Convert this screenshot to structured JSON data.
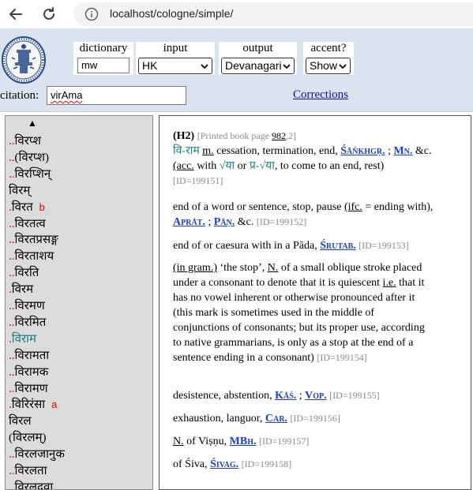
{
  "browser": {
    "url": "localhost/cologne/simple/"
  },
  "header": {
    "dictionary": {
      "label": "dictionary",
      "value": "mw"
    },
    "input": {
      "label": "input",
      "value": "HK"
    },
    "output": {
      "label": "output",
      "value": "Devanagari"
    },
    "accent": {
      "label": "accent?",
      "value": "Show"
    },
    "citation": {
      "label": "citation:",
      "value": "virAma"
    },
    "corrections": "Corrections"
  },
  "list": {
    "up_arrow": "▲",
    "items": [
      {
        "dots": "..",
        "text": "विरप्श",
        "mark": ""
      },
      {
        "dots": "..",
        "text": "(विरप्श)",
        "mark": ""
      },
      {
        "dots": "..",
        "text": "विरप्शिन्",
        "mark": ""
      },
      {
        "dots": "",
        "text": "विरम्",
        "mark": ""
      },
      {
        "dots": ".",
        "text": "विरत",
        "mark": "b"
      },
      {
        "dots": "..",
        "text": "विरतत्व",
        "mark": ""
      },
      {
        "dots": "..",
        "text": "विरतप्रसङ्ग",
        "mark": ""
      },
      {
        "dots": "..",
        "text": "विरताशय",
        "mark": ""
      },
      {
        "dots": "..",
        "text": "विरति",
        "mark": ""
      },
      {
        "dots": ".",
        "text": "विरम",
        "mark": ""
      },
      {
        "dots": "..",
        "text": "विरमण",
        "mark": ""
      },
      {
        "dots": "..",
        "text": "विरमित",
        "mark": ""
      },
      {
        "dots": ".",
        "text": "विराम",
        "mark": "",
        "selected": true
      },
      {
        "dots": "..",
        "text": "विरामता",
        "mark": ""
      },
      {
        "dots": "..",
        "text": "विरामक",
        "mark": ""
      },
      {
        "dots": "..",
        "text": "विरामण",
        "mark": ""
      },
      {
        "dots": ".",
        "text": "विरिरंसा",
        "mark": "a"
      },
      {
        "dots": "",
        "text": "विरल",
        "mark": ""
      },
      {
        "dots": "",
        "text": "(विरलम्)",
        "mark": ""
      },
      {
        "dots": "..",
        "text": "विरलजानुक",
        "mark": ""
      },
      {
        "dots": "..",
        "text": "विरलता",
        "mark": ""
      },
      {
        "dots": "..",
        "text": "विरलद्रवा",
        "mark": ""
      }
    ]
  },
  "entry": {
    "hw_code": "(H2)",
    "printed_prefix": "[Printed book page ",
    "printed_page": "982",
    "printed_suffix": ",2]",
    "e1": {
      "deva": "वि-राम",
      "gram": "m.",
      "t1": "cessation, termination, end,",
      "a1": "Śāṅkhgṛ.",
      "sep": ";",
      "a2": "Mn.",
      "t2": "&c.",
      "acc": "(acc.",
      "t3": "with",
      "d1": "√या",
      "t4": "or",
      "d2": "प्र-√या",
      "t5": ", to come to an end, rest)",
      "id": "[ID=199151]"
    },
    "e2": {
      "t1": "end of a word or sentence, stop, pause",
      "ifc": "(ifc.",
      "t2": "= ending with),",
      "a1": "Aprāt.",
      "sep": ";",
      "a2": "Pāṇ.",
      "t3": "&c.",
      "id": "[ID=199152]"
    },
    "e3": {
      "t1": "end of or caesura with in a Pāda,",
      "a1": "Śrutab.",
      "id": "[ID=199153]"
    },
    "e4": {
      "gram": "(in gram.)",
      "t1": "‘the stop’,",
      "n": "N.",
      "t2": "of a small oblique stroke placed under a consonant to denote that it is quiescent",
      "ie": "i.e.",
      "t3": "that it has no vowel inherent or otherwise pronounced after it (this mark is sometimes used in the middle of conjunctions of consonants; but its proper use, according to native grammarians, is only as a stop at the end of a sentence ending in a consonant)",
      "id": "[ID=199154]"
    },
    "e5": {
      "t1": "desistence, abstention,",
      "a1": "Kāś.",
      "sep": ";",
      "a2": "Vop.",
      "id": "[ID=199155]"
    },
    "e6": {
      "t1": "exhaustion, languor,",
      "a1": "Car.",
      "id": "[ID=199156]"
    },
    "e7": {
      "n": "N.",
      "t1": "of Viṣṇu,",
      "a1": "MBh.",
      "id": "[ID=199157]"
    },
    "e8": {
      "t1": "of Śiva,",
      "a1": "Śivag.",
      "id": "[ID=199158]"
    }
  }
}
